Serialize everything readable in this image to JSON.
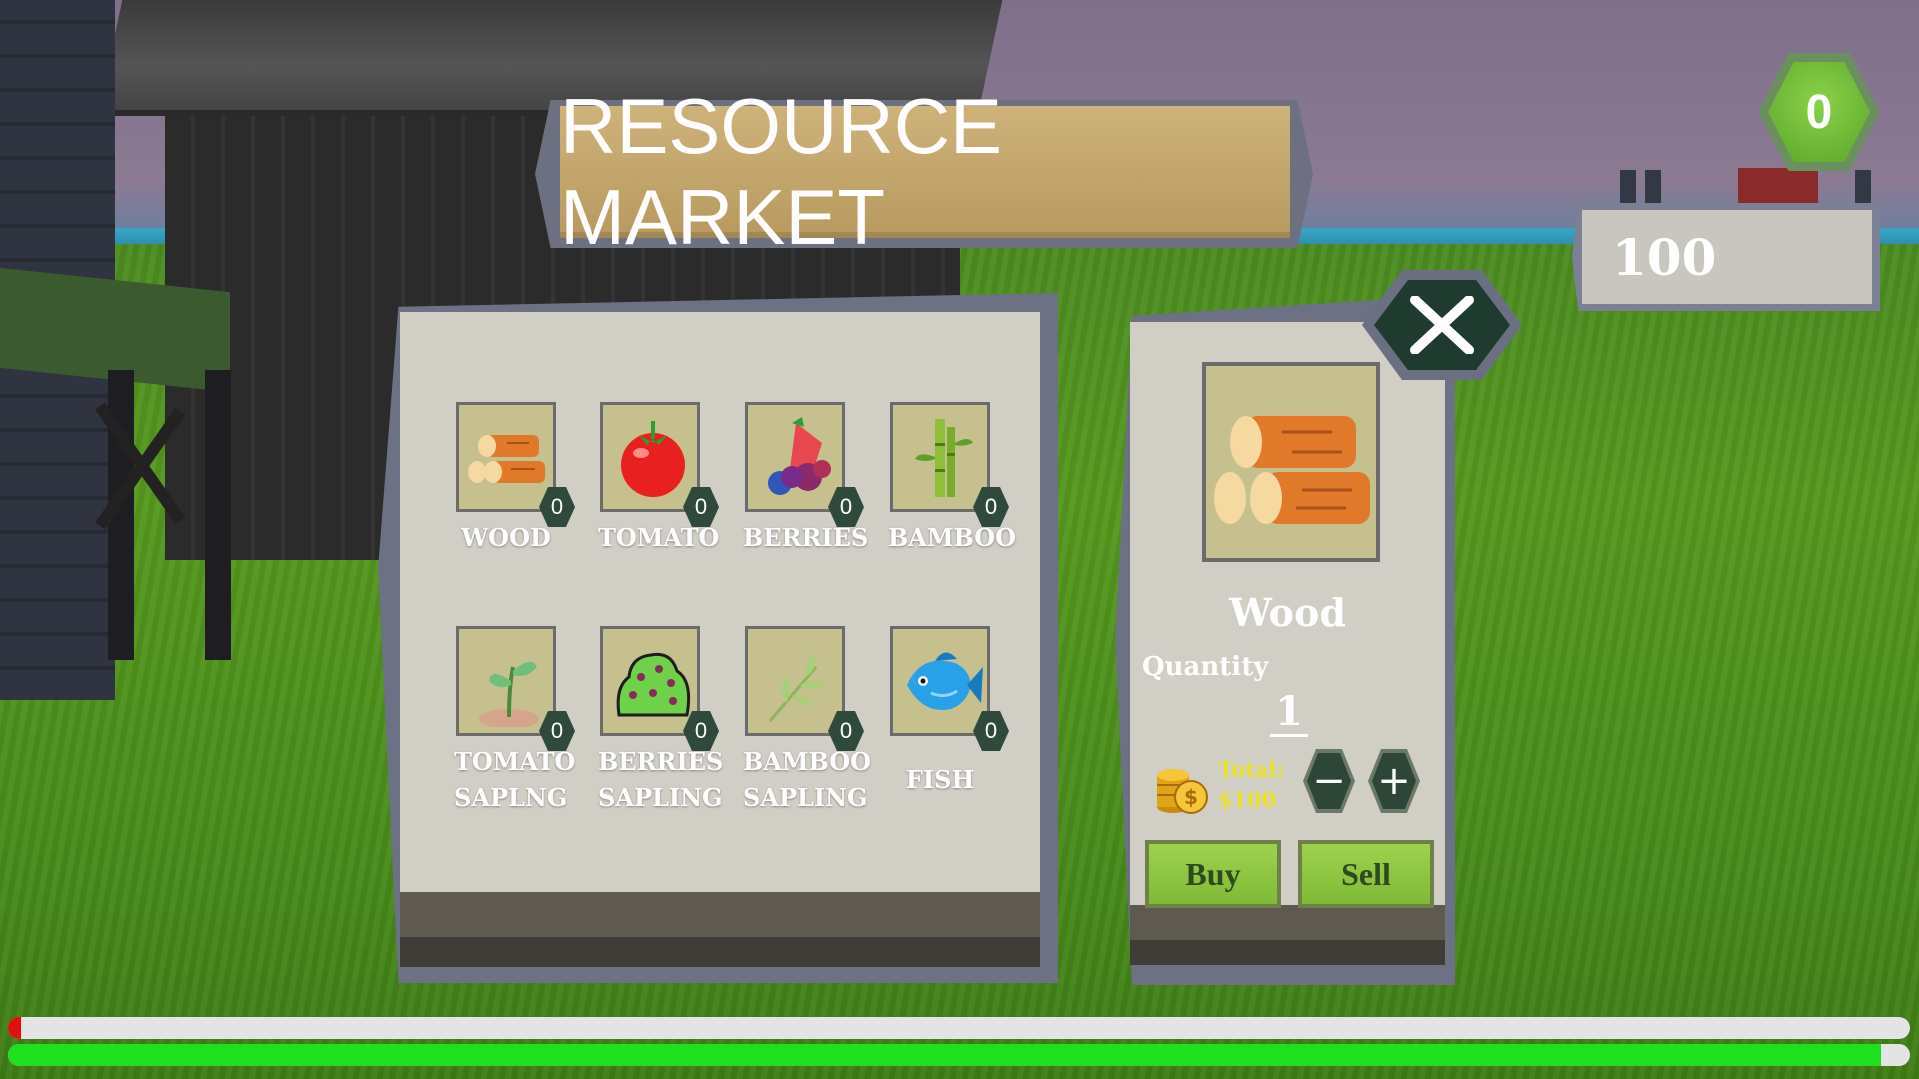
{
  "title": "RESOURCE MARKET",
  "hud": {
    "coins": "0",
    "money": "100"
  },
  "items": [
    {
      "name": "WOOD",
      "count": "0",
      "icon": "wood-icon"
    },
    {
      "name": "TOMATO",
      "count": "0",
      "icon": "tomato-icon"
    },
    {
      "name": "BERRIES",
      "count": "0",
      "icon": "berries-icon"
    },
    {
      "name": "BAMBOO",
      "count": "0",
      "icon": "bamboo-icon"
    },
    {
      "name_line1": "TOMATO",
      "name_line2": "SAPLNG",
      "count": "0",
      "icon": "tomato-sapling-icon"
    },
    {
      "name_line1": "BERRIES",
      "name_line2": "SAPLING",
      "count": "0",
      "icon": "berries-sapling-icon"
    },
    {
      "name_line1": "BAMBOO",
      "name_line2": "SAPLING",
      "count": "0",
      "icon": "bamboo-sapling-icon"
    },
    {
      "name": "FISH",
      "count": "0",
      "icon": "fish-icon"
    }
  ],
  "detail": {
    "name": "Wood",
    "quantity_label": "Quantity",
    "quantity": "1",
    "total_label": "Total:",
    "total_value": "$100",
    "minus": "−",
    "plus": "+",
    "buy": "Buy",
    "sell": "Sell"
  },
  "bars": {
    "top": {
      "fill": 0.007,
      "color": "#e01010"
    },
    "bottom": {
      "fill": 0.985,
      "color": "#1ee01e"
    }
  }
}
